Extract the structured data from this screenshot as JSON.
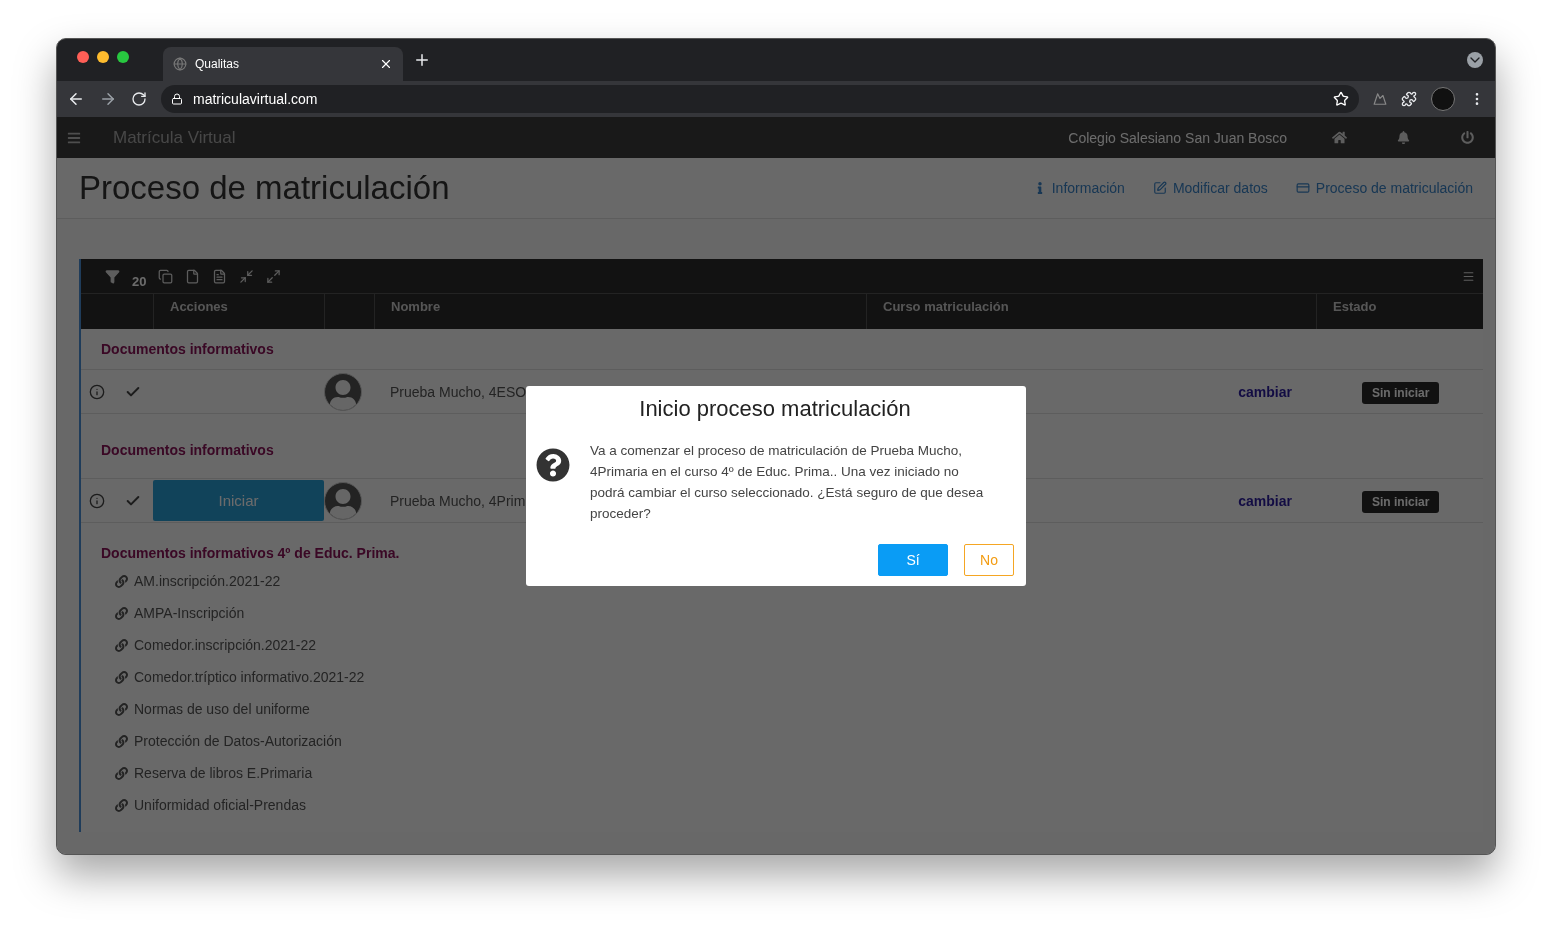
{
  "browser": {
    "tab_title": "Qualitas",
    "url": "matriculavirtual.com"
  },
  "app": {
    "brand": "Matrícula Virtual",
    "school": "Colegio Salesiano San Juan Bosco"
  },
  "page": {
    "title": "Proceso de matriculación",
    "nav": [
      {
        "label": "Información"
      },
      {
        "label": "Modificar datos"
      },
      {
        "label": "Proceso de matriculación"
      }
    ]
  },
  "table": {
    "filter_count": "20",
    "columns": [
      "Acciones",
      "Nombre",
      "Curso matriculación",
      "Estado"
    ],
    "blocks": [
      {
        "kind": "heading",
        "text": "Documentos informativos"
      },
      {
        "kind": "student",
        "name": "Prueba Mucho, 4ESO",
        "link": "cambiar",
        "status": "Sin iniciar"
      },
      {
        "kind": "heading",
        "text": "Documentos informativos"
      },
      {
        "kind": "student",
        "action": "Iniciar",
        "name": "Prueba Mucho, 4Prim",
        "link": "cambiar",
        "status": "Sin iniciar"
      },
      {
        "kind": "documents",
        "title": "Documentos informativos 4º de Educ. Prima.",
        "items": [
          "AM.inscripción.2021-22",
          "AMPA-Inscripción",
          "Comedor.inscripción.2021-22",
          "Comedor.tríptico informativo.2021-22",
          "Normas de uso del uniforme",
          "Protección de Datos-Autorización",
          "Reserva de libros E.Primaria",
          "Uniformidad oficial-Prendas"
        ]
      }
    ]
  },
  "dialog": {
    "title": "Inicio proceso matriculación",
    "message": "Va a comenzar el proceso de matriculación de Prueba Mucho, 4Primaria en el curso 4º de Educ. Prima.. Una vez iniciado no podrá cambiar el curso seleccionado. ¿Está seguro de que desea proceder?",
    "buttons": [
      {
        "label": "Sí",
        "kind": "primary"
      },
      {
        "label": "No",
        "kind": "secondary"
      }
    ]
  }
}
